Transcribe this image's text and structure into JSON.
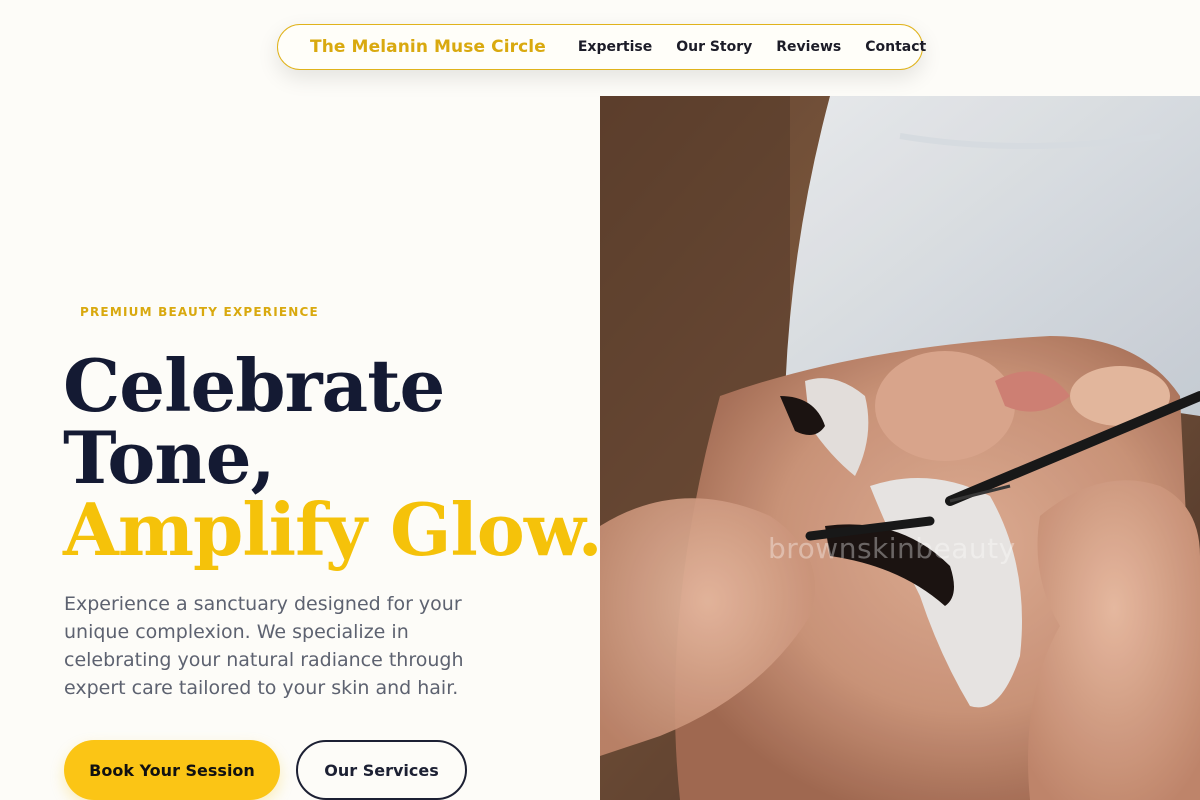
{
  "nav": {
    "brand": "The Melanin Muse Circle",
    "links": [
      "Expertise",
      "Our Story",
      "Reviews",
      "Contact"
    ]
  },
  "hero": {
    "eyebrow": "PREMIUM BEAUTY EXPERIENCE",
    "headline_line1": "Celebrate",
    "headline_line2": "Tone,",
    "headline_accent": "Amplify Glow.",
    "description": "Experience a sanctuary designed for your unique complexion. We specialize in celebrating your natural radiance through expert care tailored to your skin and hair.",
    "primary_cta": "Book Your Session",
    "secondary_cta": "Our Services"
  },
  "image": {
    "watermark": "brownskinbeauty",
    "alt_icon": "lash-extension-photo"
  },
  "colors": {
    "accent": "#f5c20a",
    "brand": "#d9a90f",
    "heading": "#141a33",
    "body_text": "#5d6270",
    "background": "#fdfcf8"
  }
}
